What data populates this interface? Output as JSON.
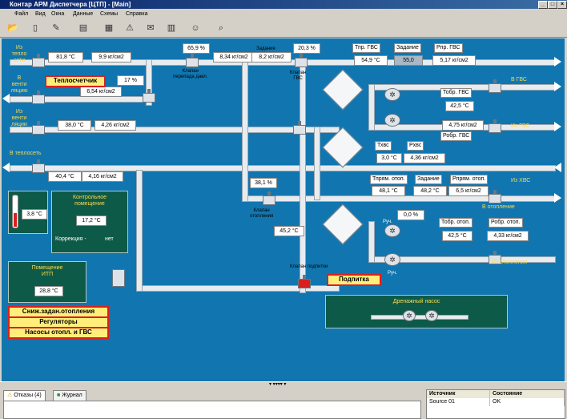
{
  "window": {
    "title": "Контар АРМ Диспетчера [ЦТП] - [Main]",
    "btn_min": "_",
    "btn_max": "□",
    "btn_close": "×"
  },
  "menu": [
    "Файл",
    "Вид",
    "Окна",
    "Данные",
    "Схемы",
    "Справка"
  ],
  "toolbar": [
    "open-icon",
    "document-icon",
    "edit-icon",
    "print-icon",
    "grid-icon",
    "alarm-icon",
    "mail-icon",
    "chart-icon",
    "users-icon",
    "search-icon"
  ],
  "scheme": {
    "labels": {
      "in_heat": "Из\nтепло\nсети",
      "to_vent": "В\nвенти\nляцию",
      "from_vent": "Из\nвенти\nляции",
      "to_heatnet": "В теплосеть",
      "to_gvs": "В ГВС",
      "from_gvs": "Из ГВС",
      "from_hvs": "Из ХВС",
      "to_heating": "В отопление",
      "from_heating": "Из отопления",
      "valve_bypass": "Клапан\nперепада давл.",
      "valve_gvs": "Клапан\nГВС",
      "valve_heating": "Клапан\nотопления",
      "valve_feed": "Клапан подпитки",
      "setpoint": "Задание",
      "tpr_gvs": "Тпр. ГВС",
      "setpoint_gvs": "Задание",
      "ppr_gvs": "Рпр. ГВС",
      "tobr_gvs": "Тобр. ГВС",
      "pobr_gvs": "Робр. ГВС",
      "thvs": "Тхвс",
      "phvs": "Рхвс",
      "tpr_heat": "Тпрям. отоп.",
      "setpoint_heat": "Задание",
      "ppr_heat": "Рпрям. отоп.",
      "tobr_heat": "Тобр. отоп.",
      "pobr_heat": "Робр. отоп.",
      "hand1": "Руч.",
      "hand2": "Руч."
    },
    "values": {
      "t_in": "81,8 °C",
      "g_in": "9,9 кг/см2",
      "bypass_pct": "65,9 %",
      "p_mid": "8,34 кг/см2",
      "setpoint_p": "8,2 кг/см2",
      "gvs_pct": "20,3 %",
      "vent_pct": "17 %",
      "vent_p": "6,54 кг/см2",
      "t_from_vent": "38,0 °C",
      "p_from_vent": "4,26 кг/см2",
      "t_heatnet": "40,4 °C",
      "p_heatnet": "4,16 кг/см2",
      "tpr_gvs": "54,9 °C",
      "setpoint_gvs": "55,0",
      "ppr_gvs": "5,17 кг/см2",
      "tobr_gvs": "42,5 °C",
      "pobr_gvs": "4,75 кг/см2",
      "thvs": "3,0 °C",
      "phvs": "4,36 кг/см2",
      "tpr_heat": "48,1 °C",
      "setpoint_heat": "48,2 °C",
      "ppr_heat": "6,5 кг/см2",
      "heat_valve_pct": "38,1 %",
      "heat_mid": "45,2 °C",
      "pump_pct": "0,0 %",
      "tobr_heat": "42,5 °C",
      "pobr_heat": "4,33 кг/см2"
    },
    "outdoor": {
      "temp": "3,8 °C"
    },
    "control_room": {
      "title": "Контрольное\nпомещение",
      "temp": "17,2 °C",
      "corr_label": "Коррекция -",
      "corr_value": "нет"
    },
    "itp_room": {
      "title": "Помещение\nИТП",
      "temp": "28,8 °C"
    },
    "buttons": {
      "heat_meter": "Теплосчетчик",
      "feed": "Подпитка",
      "lower_setpoint": "Сниж.задан.отопления",
      "regulators": "Регуляторы",
      "pumps": "Насосы отопл. и ГВС"
    },
    "drain": {
      "title": "Дренажный насос"
    }
  },
  "bottom": {
    "tabs": [
      "Отказы (4)",
      "Журнал"
    ],
    "grid_headers": [
      "Источник",
      "Состояние"
    ],
    "grid_rows": [
      [
        "Source 01",
        "OK"
      ]
    ],
    "splitter_mark": "▾ ▾▾▾▾ ▾"
  }
}
